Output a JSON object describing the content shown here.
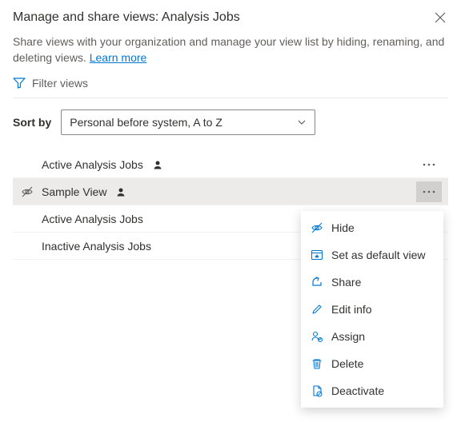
{
  "header": {
    "title": "Manage and share views: Analysis Jobs"
  },
  "description": {
    "text": "Share views with your organization and manage your view list by hiding, renaming, and deleting views. ",
    "link_label": "Learn more"
  },
  "filter": {
    "label": "Filter views"
  },
  "sort": {
    "label": "Sort by",
    "value": "Personal before system, A to Z"
  },
  "views": [
    {
      "name": "Active Analysis Jobs",
      "personal": true,
      "hidden": false,
      "selected": false,
      "show_more": true
    },
    {
      "name": "Sample View",
      "personal": true,
      "hidden": true,
      "selected": true,
      "show_more": true
    },
    {
      "name": "Active Analysis Jobs",
      "personal": false,
      "hidden": false,
      "selected": false,
      "show_more": false
    },
    {
      "name": "Inactive Analysis Jobs",
      "personal": false,
      "hidden": false,
      "selected": false,
      "show_more": false
    }
  ],
  "context_menu": [
    {
      "icon": "hide",
      "label": "Hide"
    },
    {
      "icon": "default",
      "label": "Set as default view"
    },
    {
      "icon": "share",
      "label": "Share"
    },
    {
      "icon": "edit",
      "label": "Edit info"
    },
    {
      "icon": "assign",
      "label": "Assign"
    },
    {
      "icon": "delete",
      "label": "Delete"
    },
    {
      "icon": "deactivate",
      "label": "Deactivate"
    }
  ]
}
